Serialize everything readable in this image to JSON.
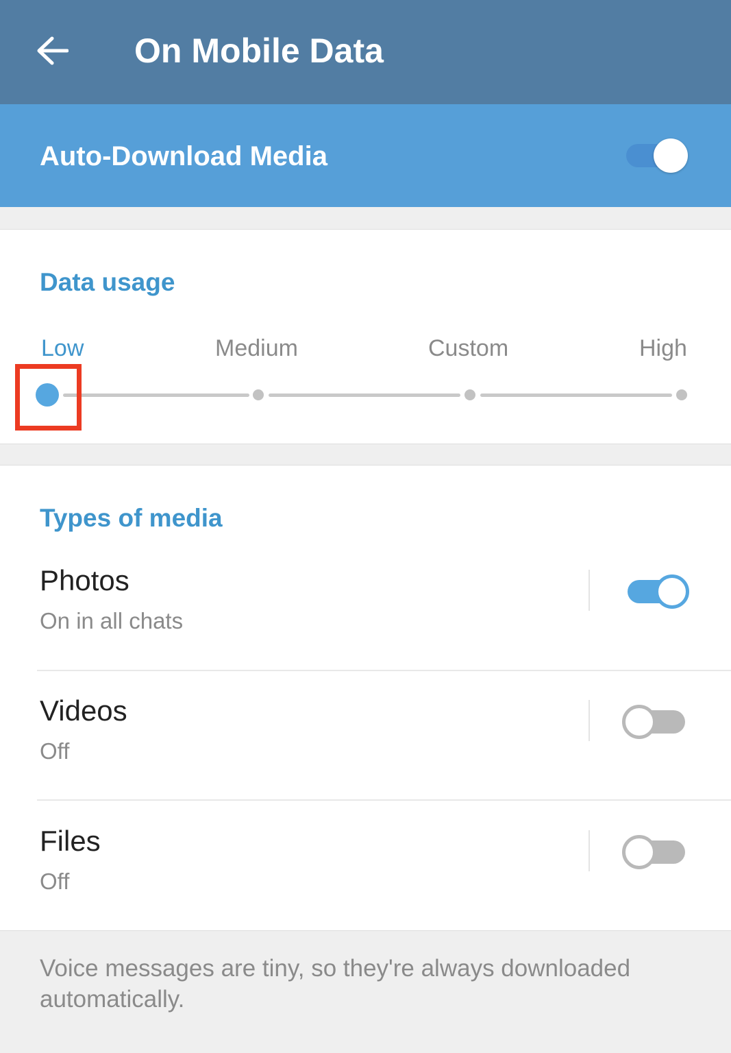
{
  "toolbar": {
    "title": "On Mobile Data",
    "back_icon": "arrow-left-icon"
  },
  "master_toggle": {
    "label": "Auto-Download Media",
    "checked": true
  },
  "data_usage": {
    "header": "Data usage",
    "levels": [
      "Low",
      "Medium",
      "Custom",
      "High"
    ],
    "selected_index": 0
  },
  "media_types": {
    "header": "Types of media",
    "items": [
      {
        "title": "Photos",
        "status": "On in all chats",
        "enabled": true
      },
      {
        "title": "Videos",
        "status": "Off",
        "enabled": false
      },
      {
        "title": "Files",
        "status": "Off",
        "enabled": false
      }
    ]
  },
  "footer": {
    "note": "Voice messages are tiny, so they're always downloaded automatically."
  },
  "colors": {
    "toolbar_bg": "#527da3",
    "master_bg": "#569fd8",
    "accent": "#3f95cc",
    "switch_on_track": "#4a8fd1",
    "switch_on_blue": "#56a7e0",
    "switch_off_track": "#b9b9b9",
    "highlight": "#ec3b22"
  }
}
